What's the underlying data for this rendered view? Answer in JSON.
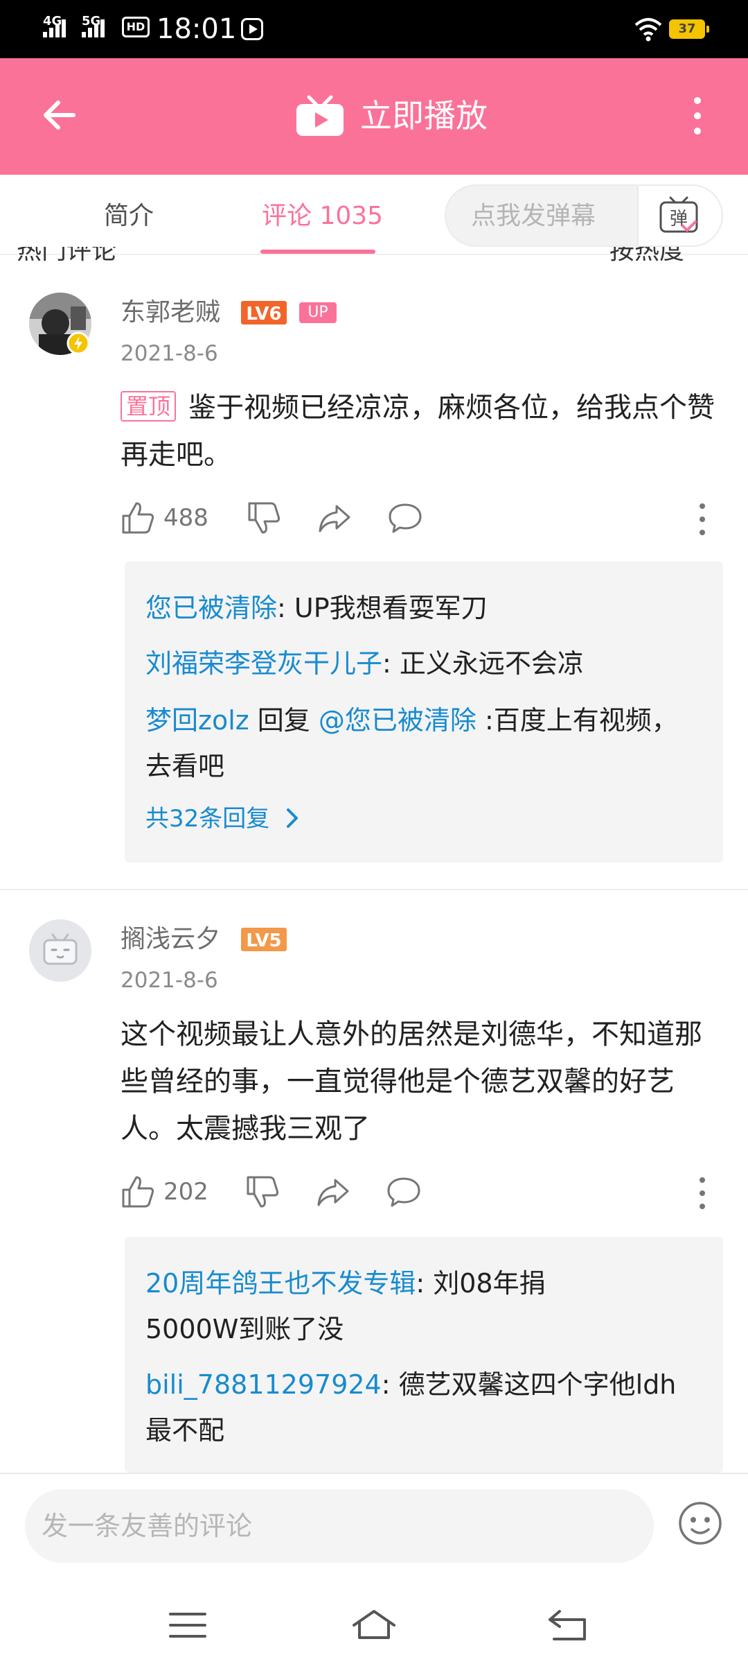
{
  "status_bar": {
    "network_1": "4G",
    "network_2": "5G",
    "hd_label": "HD",
    "time": "18:01",
    "battery": "37"
  },
  "header": {
    "title": "立即播放"
  },
  "tabs": {
    "intro_label": "简介",
    "comments_label": "评论 1035",
    "danmu_placeholder": "点我发弹幕",
    "danmu_button_text": "弹"
  },
  "hidden_row": {
    "left": "热门评论",
    "right": "按热度"
  },
  "comments": [
    {
      "username": "东郭老贼",
      "level": "LV6",
      "up_badge": "UP",
      "date": "2021-8-6",
      "pinned_label": "置顶",
      "text": "鉴于视频已经凉凉，麻烦各位，给我点个赞再走吧。",
      "likes": "488",
      "replies": [
        {
          "name": "您已被清除",
          "text": ": UP我想看耍军刀"
        },
        {
          "name": "刘福荣李登灰干儿子",
          "text": ": 正义永远不会凉"
        },
        {
          "name": "梦回zolz",
          "mid": " 回复 ",
          "mention": "@您已被清除",
          "text": " :百度上有视频，去看吧"
        }
      ],
      "reply_total": "共32条回复"
    },
    {
      "username": "搁浅云夕",
      "level": "LV5",
      "date": "2021-8-6",
      "text": "这个视频最让人意外的居然是刘德华，不知道那些曾经的事，一直觉得他是个德艺双馨的好艺人。太震撼我三观了",
      "likes": "202",
      "replies": [
        {
          "name": "20周年鸽王也不发专辑",
          "text": ": 刘08年捐5000W到账了没"
        },
        {
          "name": "bili_78811297924",
          "text": ": 德艺双馨这四个字他ldh 最不配"
        }
      ]
    }
  ],
  "bottom_bar": {
    "placeholder": "发一条友善的评论"
  },
  "colors": {
    "brand_pink": "#fb7299",
    "link_blue": "#178bcf",
    "lv6_orange": "#f2652a",
    "lv5_orange": "#f2994a"
  }
}
